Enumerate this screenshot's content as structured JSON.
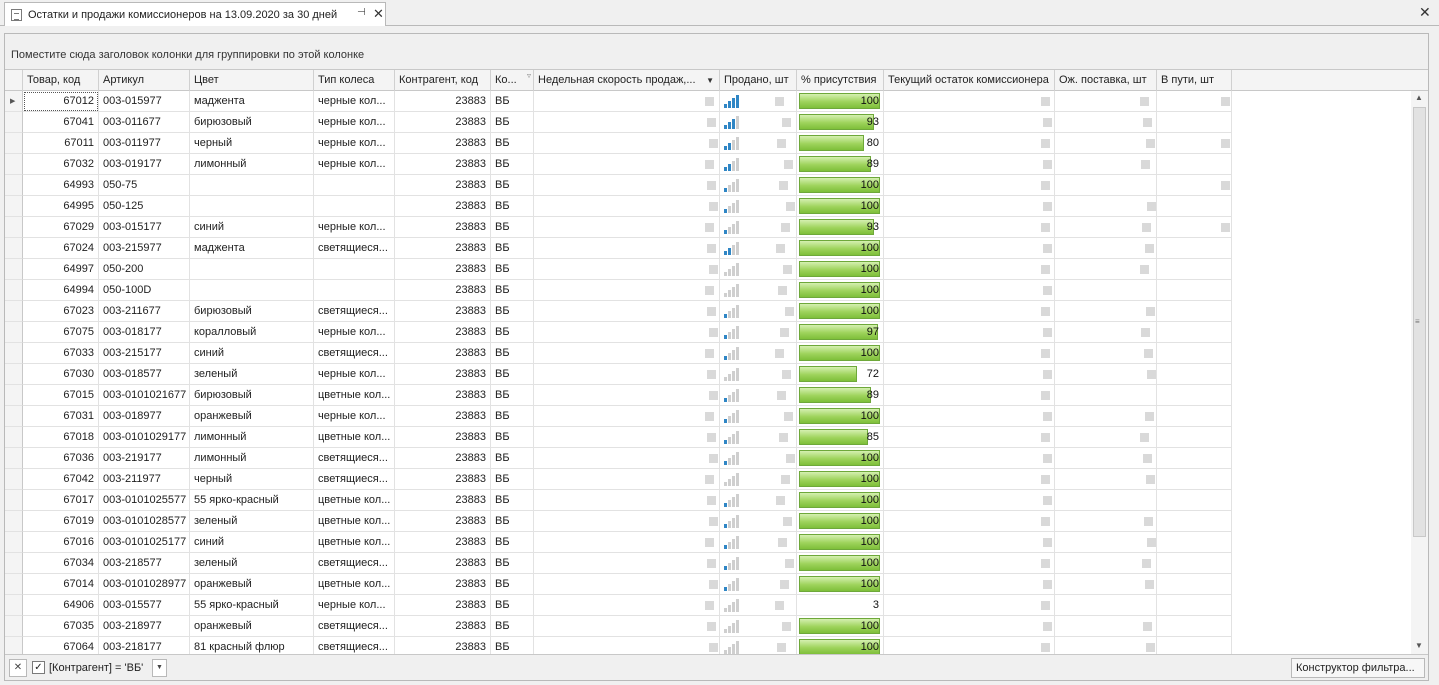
{
  "tab": {
    "title": "Остатки и продажи комиссионеров на 13.09.2020 за 30 дней",
    "pin_glyph": "⊣",
    "close_glyph": "✕"
  },
  "window": {
    "close_glyph": "✕"
  },
  "group_panel": {
    "hint": "Поместите сюда заголовок колонки для группировки по этой колонке"
  },
  "columns": [
    "Товар, код",
    "Артикул",
    "Цвет",
    "Тип колеса",
    "Контрагент, код",
    "Ко...",
    "Недельная скорость продаж,...",
    "Продано, шт",
    "% присутствия",
    "Текущий остаток комиссионера",
    "Ож. поставка, шт",
    "В пути, шт"
  ],
  "rows": [
    {
      "code": "67012",
      "art": "003-015977",
      "color": "маджента",
      "wheel": "черные кол...",
      "agent": "23883",
      "k": "ВБ",
      "sig": 4,
      "pct": 100
    },
    {
      "code": "67041",
      "art": "003-011677",
      "color": "бирюзовый",
      "wheel": "черные кол...",
      "agent": "23883",
      "k": "ВБ",
      "sig": 3,
      "pct": 93
    },
    {
      "code": "67011",
      "art": "003-011977",
      "color": "черный",
      "wheel": "черные кол...",
      "agent": "23883",
      "k": "ВБ",
      "sig": 2,
      "pct": 80
    },
    {
      "code": "67032",
      "art": "003-019177",
      "color": "лимонный",
      "wheel": "черные кол...",
      "agent": "23883",
      "k": "ВБ",
      "sig": 2,
      "pct": 89
    },
    {
      "code": "64993",
      "art": "050-75",
      "color": "",
      "wheel": "",
      "agent": "23883",
      "k": "ВБ",
      "sig": 1,
      "pct": 100
    },
    {
      "code": "64995",
      "art": "050-125",
      "color": "",
      "wheel": "",
      "agent": "23883",
      "k": "ВБ",
      "sig": 1,
      "pct": 100
    },
    {
      "code": "67029",
      "art": "003-015177",
      "color": "синий",
      "wheel": "черные кол...",
      "agent": "23883",
      "k": "ВБ",
      "sig": 1,
      "pct": 93
    },
    {
      "code": "67024",
      "art": "003-215977",
      "color": "маджента",
      "wheel": "светящиеся...",
      "agent": "23883",
      "k": "ВБ",
      "sig": 2,
      "pct": 100
    },
    {
      "code": "64997",
      "art": "050-200",
      "color": "",
      "wheel": "",
      "agent": "23883",
      "k": "ВБ",
      "sig": 0,
      "pct": 100
    },
    {
      "code": "64994",
      "art": "050-100D",
      "color": "",
      "wheel": "",
      "agent": "23883",
      "k": "ВБ",
      "sig": 0,
      "pct": 100
    },
    {
      "code": "67023",
      "art": "003-211677",
      "color": "бирюзовый",
      "wheel": "светящиеся...",
      "agent": "23883",
      "k": "ВБ",
      "sig": 1,
      "pct": 100
    },
    {
      "code": "67075",
      "art": "003-018177",
      "color": "коралловый",
      "wheel": "черные кол...",
      "agent": "23883",
      "k": "ВБ",
      "sig": 1,
      "pct": 97
    },
    {
      "code": "67033",
      "art": "003-215177",
      "color": "синий",
      "wheel": "светящиеся...",
      "agent": "23883",
      "k": "ВБ",
      "sig": 1,
      "pct": 100
    },
    {
      "code": "67030",
      "art": "003-018577",
      "color": "зеленый",
      "wheel": "черные кол...",
      "agent": "23883",
      "k": "ВБ",
      "sig": 0,
      "pct": 72
    },
    {
      "code": "67015",
      "art": "003-0101021677",
      "color": "бирюзовый",
      "wheel": "цветные кол...",
      "agent": "23883",
      "k": "ВБ",
      "sig": 1,
      "pct": 89
    },
    {
      "code": "67031",
      "art": "003-018977",
      "color": "оранжевый",
      "wheel": "черные кол...",
      "agent": "23883",
      "k": "ВБ",
      "sig": 1,
      "pct": 100
    },
    {
      "code": "67018",
      "art": "003-0101029177",
      "color": "лимонный",
      "wheel": "цветные кол...",
      "agent": "23883",
      "k": "ВБ",
      "sig": 1,
      "pct": 85
    },
    {
      "code": "67036",
      "art": "003-219177",
      "color": "лимонный",
      "wheel": "светящиеся...",
      "agent": "23883",
      "k": "ВБ",
      "sig": 1,
      "pct": 100
    },
    {
      "code": "67042",
      "art": "003-211977",
      "color": "черный",
      "wheel": "светящиеся...",
      "agent": "23883",
      "k": "ВБ",
      "sig": 0,
      "pct": 100
    },
    {
      "code": "67017",
      "art": "003-0101025577",
      "color": "55 ярко-красный",
      "wheel": "цветные кол...",
      "agent": "23883",
      "k": "ВБ",
      "sig": 1,
      "pct": 100
    },
    {
      "code": "67019",
      "art": "003-0101028577",
      "color": "зеленый",
      "wheel": "цветные кол...",
      "agent": "23883",
      "k": "ВБ",
      "sig": 1,
      "pct": 100
    },
    {
      "code": "67016",
      "art": "003-0101025177",
      "color": "синий",
      "wheel": "цветные кол...",
      "agent": "23883",
      "k": "ВБ",
      "sig": 1,
      "pct": 100
    },
    {
      "code": "67034",
      "art": "003-218577",
      "color": "зеленый",
      "wheel": "светящиеся...",
      "agent": "23883",
      "k": "ВБ",
      "sig": 1,
      "pct": 100
    },
    {
      "code": "67014",
      "art": "003-0101028977",
      "color": "оранжевый",
      "wheel": "цветные кол...",
      "agent": "23883",
      "k": "ВБ",
      "sig": 1,
      "pct": 100
    },
    {
      "code": "64906",
      "art": "003-015577",
      "color": "55 ярко-красный",
      "wheel": "черные кол...",
      "agent": "23883",
      "k": "ВБ",
      "sig": 0,
      "pct": 3
    },
    {
      "code": "67035",
      "art": "003-218977",
      "color": "оранжевый",
      "wheel": "светящиеся...",
      "agent": "23883",
      "k": "ВБ",
      "sig": 0,
      "pct": 100
    },
    {
      "code": "67064",
      "art": "003-218177",
      "color": "81 красный флюр",
      "wheel": "светящиеся...",
      "agent": "23883",
      "k": "ВБ",
      "sig": 0,
      "pct": 100
    }
  ],
  "filter_panel": {
    "clear_glyph": "✕",
    "checked_glyph": "✓",
    "expression": "[Контрагент] = 'ВБ'",
    "dropdown_glyph": "▼",
    "builder_label": "Конструктор фильтра..."
  },
  "colors": {
    "progress_green": "#9ed35c",
    "signal_blue": "#2f86c5",
    "signal_gray": "#cfcfcf"
  },
  "icons": {
    "row_focus": "row-indicator-icon",
    "sort": "sort-desc-icon",
    "filter": "filter-icon"
  }
}
